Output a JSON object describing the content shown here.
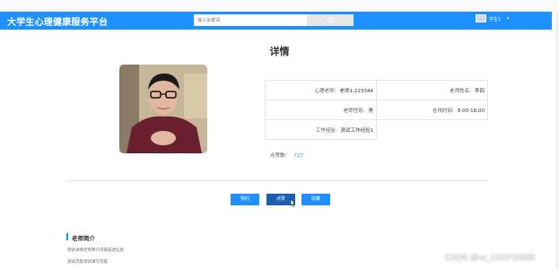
{
  "header": {
    "brand": "大学生心理健康服务平台",
    "search_placeholder": "输入关键词",
    "user_name": "学生1",
    "caret": "▾"
  },
  "page": {
    "title": "详情"
  },
  "teacher": {
    "rows": [
      {
        "left_label": "心理老师:",
        "left_value": "老师1-223344",
        "right_label": "老师姓名:",
        "right_value": "李四"
      },
      {
        "left_label": "老师性别:",
        "left_value": "男",
        "right_label": "在线时间:",
        "right_value": "8:00-18:00"
      },
      {
        "left_label": "工作经验:",
        "left_value": "测试工作经验1",
        "right_label": "",
        "right_value": ""
      }
    ],
    "likes_label": "点赞数:",
    "likes_value": "727"
  },
  "actions": {
    "reserve": "预约",
    "like": "点赞",
    "favorite": "收藏"
  },
  "intro": {
    "title": "老师简介",
    "line1": "测试详情老师简介内容描述信息",
    "line2": "测试内容测试填写内容"
  },
  "watermark": "CSDN @vx_CXKF10088",
  "colors": {
    "primary": "#1e90ff",
    "header_bg": "#1e90ff",
    "like_button": "#1a5fb4"
  }
}
